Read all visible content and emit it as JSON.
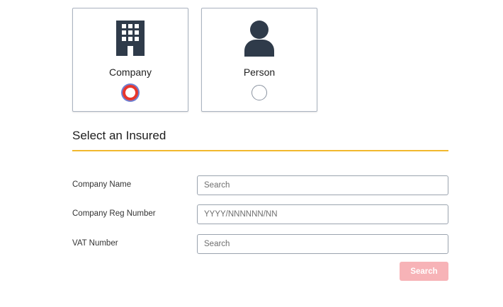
{
  "insured_type": {
    "options": [
      {
        "label": "Company",
        "icon": "building-icon",
        "selected": true
      },
      {
        "label": "Person",
        "icon": "person-icon",
        "selected": false
      }
    ]
  },
  "section": {
    "title": "Select an Insured"
  },
  "form": {
    "company_name": {
      "label": "Company Name",
      "placeholder": "Search",
      "value": ""
    },
    "company_reg": {
      "label": "Company Reg Number",
      "placeholder": "YYYY/NNNNNN/NN",
      "value": ""
    },
    "vat_number": {
      "label": "VAT Number",
      "placeholder": "Search",
      "value": ""
    }
  },
  "search_button": {
    "label": "Search"
  },
  "colors": {
    "accent_rule": "#f1b82d",
    "radio_selected": "#e8362c",
    "button_disabled": "#f7b3b7",
    "icon": "#2f3b4a"
  }
}
